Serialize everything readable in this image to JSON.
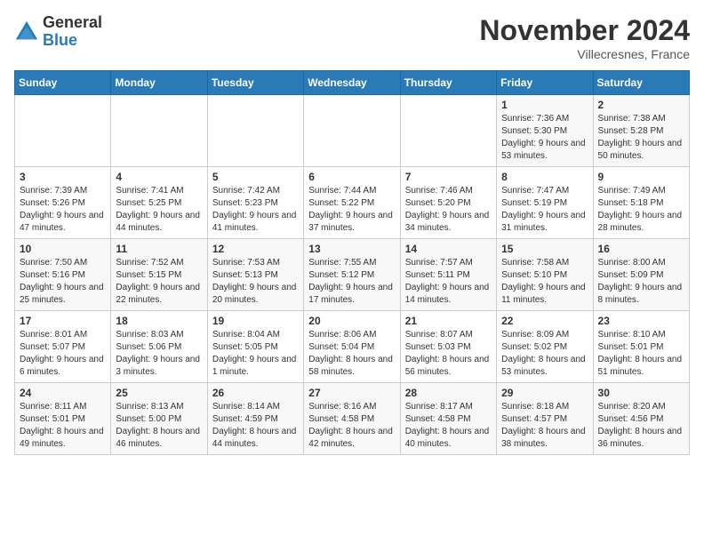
{
  "logo": {
    "general": "General",
    "blue": "Blue"
  },
  "title": "November 2024",
  "subtitle": "Villecresnes, France",
  "days_of_week": [
    "Sunday",
    "Monday",
    "Tuesday",
    "Wednesday",
    "Thursday",
    "Friday",
    "Saturday"
  ],
  "weeks": [
    [
      {
        "day": "",
        "info": ""
      },
      {
        "day": "",
        "info": ""
      },
      {
        "day": "",
        "info": ""
      },
      {
        "day": "",
        "info": ""
      },
      {
        "day": "",
        "info": ""
      },
      {
        "day": "1",
        "info": "Sunrise: 7:36 AM\nSunset: 5:30 PM\nDaylight: 9 hours and 53 minutes."
      },
      {
        "day": "2",
        "info": "Sunrise: 7:38 AM\nSunset: 5:28 PM\nDaylight: 9 hours and 50 minutes."
      }
    ],
    [
      {
        "day": "3",
        "info": "Sunrise: 7:39 AM\nSunset: 5:26 PM\nDaylight: 9 hours and 47 minutes."
      },
      {
        "day": "4",
        "info": "Sunrise: 7:41 AM\nSunset: 5:25 PM\nDaylight: 9 hours and 44 minutes."
      },
      {
        "day": "5",
        "info": "Sunrise: 7:42 AM\nSunset: 5:23 PM\nDaylight: 9 hours and 41 minutes."
      },
      {
        "day": "6",
        "info": "Sunrise: 7:44 AM\nSunset: 5:22 PM\nDaylight: 9 hours and 37 minutes."
      },
      {
        "day": "7",
        "info": "Sunrise: 7:46 AM\nSunset: 5:20 PM\nDaylight: 9 hours and 34 minutes."
      },
      {
        "day": "8",
        "info": "Sunrise: 7:47 AM\nSunset: 5:19 PM\nDaylight: 9 hours and 31 minutes."
      },
      {
        "day": "9",
        "info": "Sunrise: 7:49 AM\nSunset: 5:18 PM\nDaylight: 9 hours and 28 minutes."
      }
    ],
    [
      {
        "day": "10",
        "info": "Sunrise: 7:50 AM\nSunset: 5:16 PM\nDaylight: 9 hours and 25 minutes."
      },
      {
        "day": "11",
        "info": "Sunrise: 7:52 AM\nSunset: 5:15 PM\nDaylight: 9 hours and 22 minutes."
      },
      {
        "day": "12",
        "info": "Sunrise: 7:53 AM\nSunset: 5:13 PM\nDaylight: 9 hours and 20 minutes."
      },
      {
        "day": "13",
        "info": "Sunrise: 7:55 AM\nSunset: 5:12 PM\nDaylight: 9 hours and 17 minutes."
      },
      {
        "day": "14",
        "info": "Sunrise: 7:57 AM\nSunset: 5:11 PM\nDaylight: 9 hours and 14 minutes."
      },
      {
        "day": "15",
        "info": "Sunrise: 7:58 AM\nSunset: 5:10 PM\nDaylight: 9 hours and 11 minutes."
      },
      {
        "day": "16",
        "info": "Sunrise: 8:00 AM\nSunset: 5:09 PM\nDaylight: 9 hours and 8 minutes."
      }
    ],
    [
      {
        "day": "17",
        "info": "Sunrise: 8:01 AM\nSunset: 5:07 PM\nDaylight: 9 hours and 6 minutes."
      },
      {
        "day": "18",
        "info": "Sunrise: 8:03 AM\nSunset: 5:06 PM\nDaylight: 9 hours and 3 minutes."
      },
      {
        "day": "19",
        "info": "Sunrise: 8:04 AM\nSunset: 5:05 PM\nDaylight: 9 hours and 1 minute."
      },
      {
        "day": "20",
        "info": "Sunrise: 8:06 AM\nSunset: 5:04 PM\nDaylight: 8 hours and 58 minutes."
      },
      {
        "day": "21",
        "info": "Sunrise: 8:07 AM\nSunset: 5:03 PM\nDaylight: 8 hours and 56 minutes."
      },
      {
        "day": "22",
        "info": "Sunrise: 8:09 AM\nSunset: 5:02 PM\nDaylight: 8 hours and 53 minutes."
      },
      {
        "day": "23",
        "info": "Sunrise: 8:10 AM\nSunset: 5:01 PM\nDaylight: 8 hours and 51 minutes."
      }
    ],
    [
      {
        "day": "24",
        "info": "Sunrise: 8:11 AM\nSunset: 5:01 PM\nDaylight: 8 hours and 49 minutes."
      },
      {
        "day": "25",
        "info": "Sunrise: 8:13 AM\nSunset: 5:00 PM\nDaylight: 8 hours and 46 minutes."
      },
      {
        "day": "26",
        "info": "Sunrise: 8:14 AM\nSunset: 4:59 PM\nDaylight: 8 hours and 44 minutes."
      },
      {
        "day": "27",
        "info": "Sunrise: 8:16 AM\nSunset: 4:58 PM\nDaylight: 8 hours and 42 minutes."
      },
      {
        "day": "28",
        "info": "Sunrise: 8:17 AM\nSunset: 4:58 PM\nDaylight: 8 hours and 40 minutes."
      },
      {
        "day": "29",
        "info": "Sunrise: 8:18 AM\nSunset: 4:57 PM\nDaylight: 8 hours and 38 minutes."
      },
      {
        "day": "30",
        "info": "Sunrise: 8:20 AM\nSunset: 4:56 PM\nDaylight: 8 hours and 36 minutes."
      }
    ]
  ]
}
